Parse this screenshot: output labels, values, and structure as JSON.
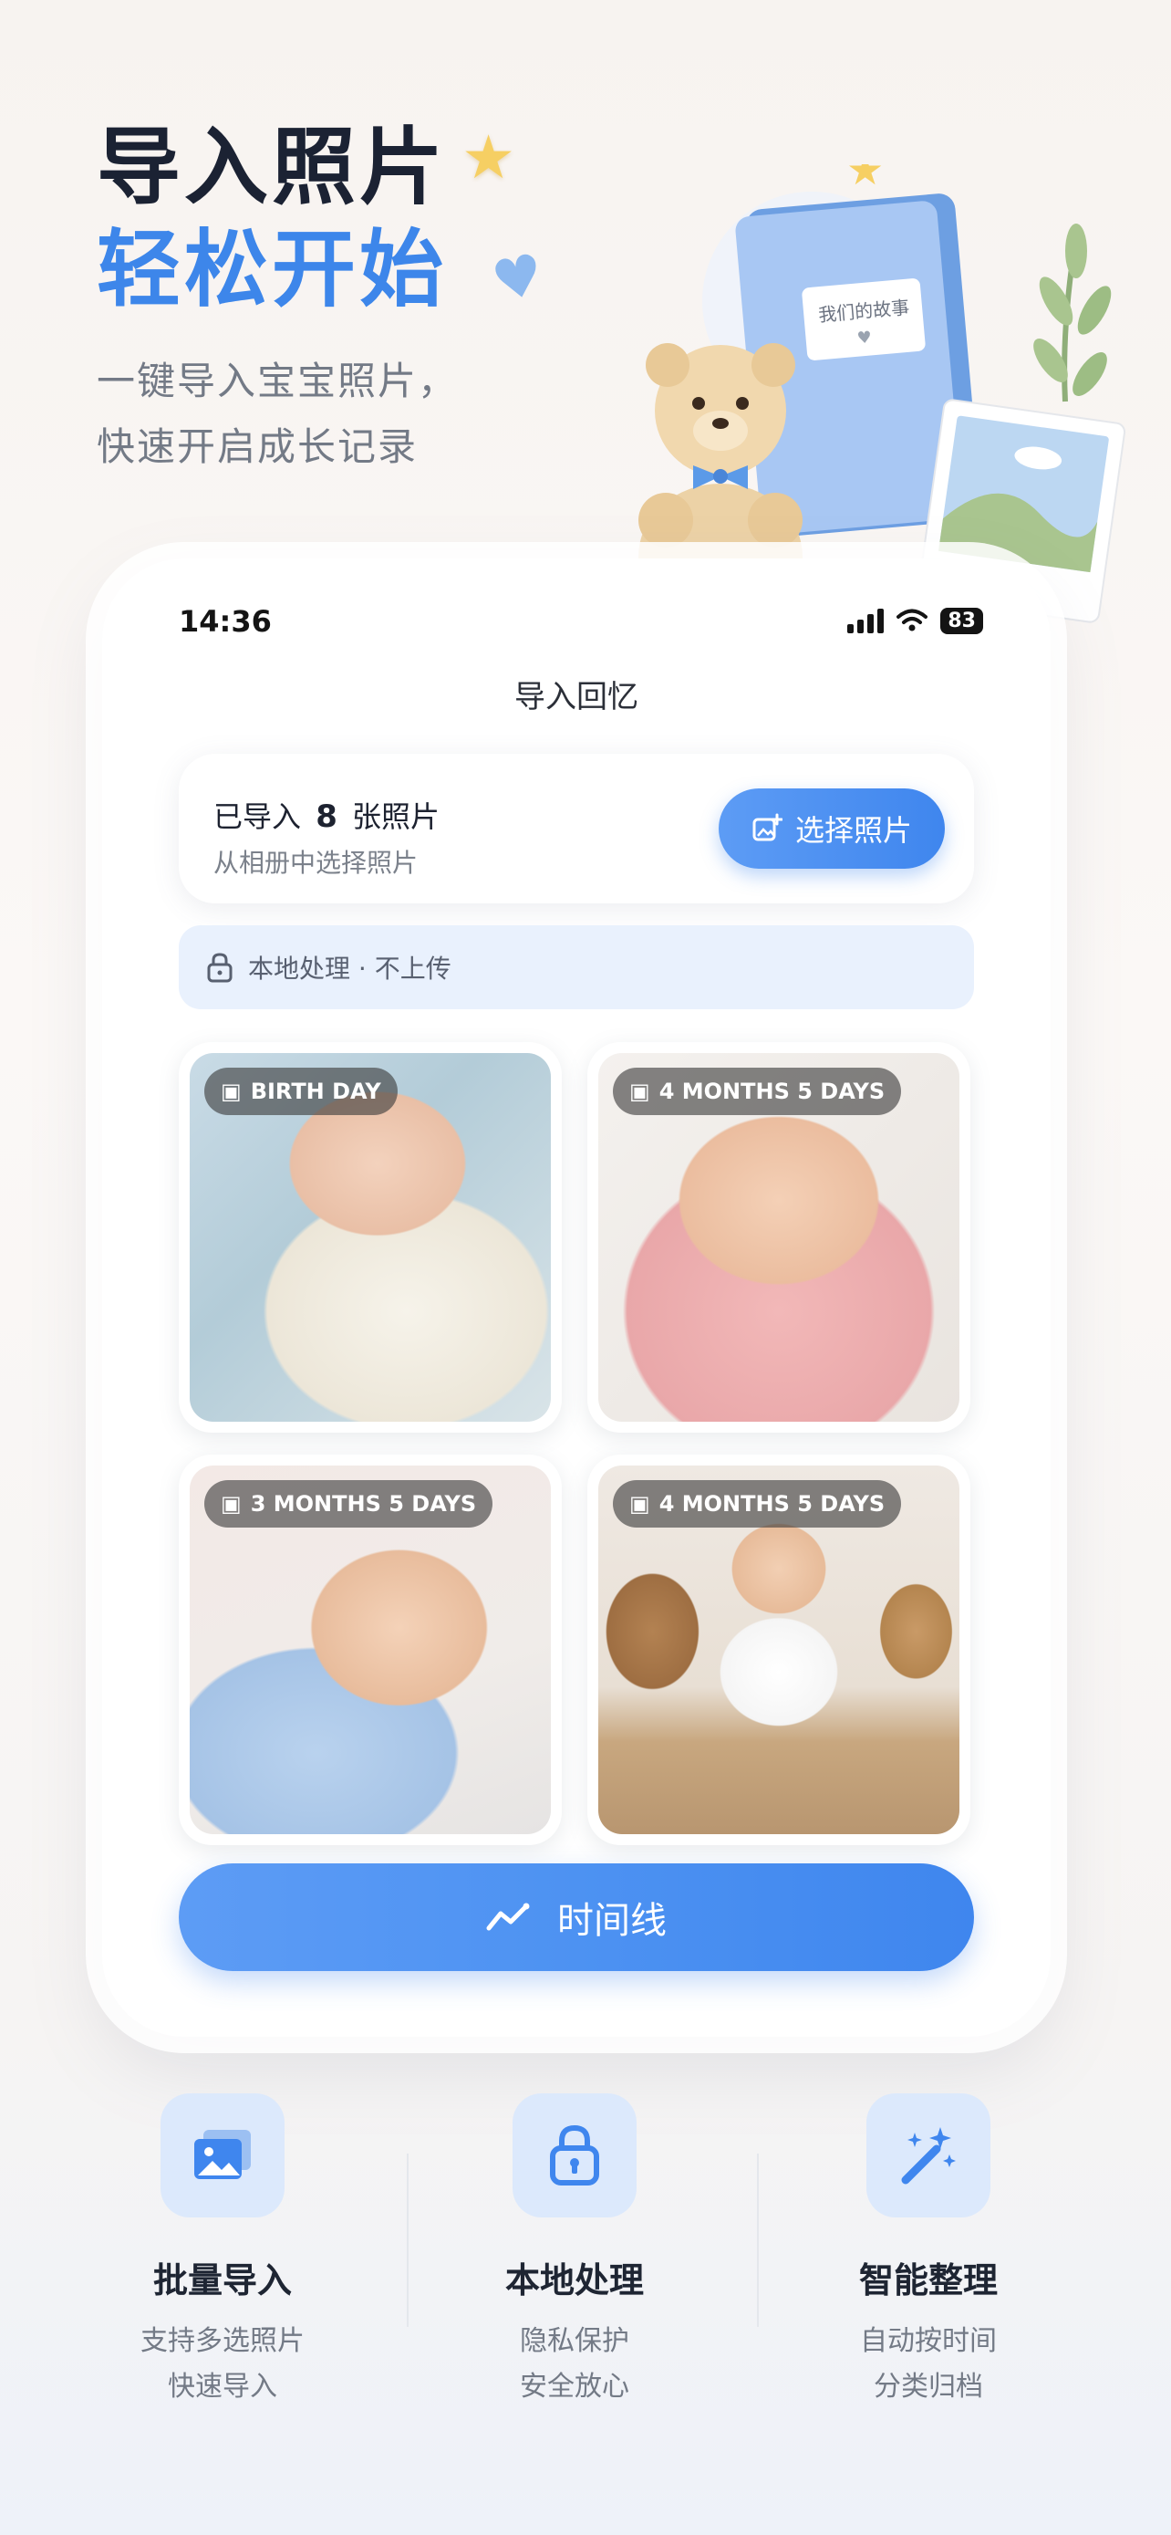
{
  "hero": {
    "title_line1": "导入照片",
    "title_line2": "轻松开始",
    "subtitle_line1": "一键导入宝宝照片，",
    "subtitle_line2": "快速开启成长记录",
    "book_label": "我们的故事"
  },
  "status_bar": {
    "time": "14:36",
    "battery": "83"
  },
  "screen": {
    "title": "导入回忆",
    "import_prefix": "已导入",
    "import_count": "8",
    "import_suffix": "张照片",
    "import_hint": "从相册中选择照片",
    "select_button": "选择照片",
    "local_notice": "本地处理 · 不上传",
    "photos": [
      {
        "label": "BIRTH DAY"
      },
      {
        "label": "4 MONTHS 5 DAYS"
      },
      {
        "label": "3 MONTHS 5 DAYS"
      },
      {
        "label": "4 MONTHS 5 DAYS"
      }
    ],
    "timeline_button": "时间线"
  },
  "features": [
    {
      "title": "批量导入",
      "desc1": "支持多选照片",
      "desc2": "快速导入",
      "icon": "image-icon"
    },
    {
      "title": "本地处理",
      "desc1": "隐私保护",
      "desc2": "安全放心",
      "icon": "lock-icon"
    },
    {
      "title": "智能整理",
      "desc1": "自动按时间",
      "desc2": "分类归档",
      "icon": "magic-wand-icon"
    }
  ],
  "colors": {
    "accent": "#3f86ee",
    "accent_light": "#e9f1fd",
    "title_dark": "#1b2233"
  }
}
